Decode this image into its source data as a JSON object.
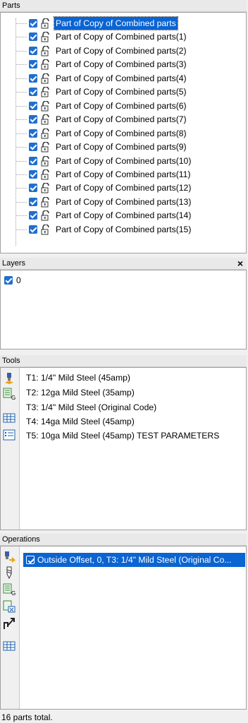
{
  "parts": {
    "title": "Parts",
    "items": [
      "Part of Copy of Combined parts",
      "Part of Copy of Combined parts(1)",
      "Part of Copy of Combined parts(2)",
      "Part of Copy of Combined parts(3)",
      "Part of Copy of Combined parts(4)",
      "Part of Copy of Combined parts(5)",
      "Part of Copy of Combined parts(6)",
      "Part of Copy of Combined parts(7)",
      "Part of Copy of Combined parts(8)",
      "Part of Copy of Combined parts(9)",
      "Part of Copy of Combined parts(10)",
      "Part of Copy of Combined parts(11)",
      "Part of Copy of Combined parts(12)",
      "Part of Copy of Combined parts(13)",
      "Part of Copy of Combined parts(14)",
      "Part of Copy of Combined parts(15)"
    ]
  },
  "layers": {
    "title": "Layers",
    "close": "×",
    "items": [
      "0"
    ]
  },
  "tools": {
    "title": "Tools",
    "items": [
      "T1: 1/4\" Mild Steel (45amp)",
      "T2: 12ga Mild Steel (35amp)",
      "T3: 1/4\" Mild Steel (Original Code)",
      "T4: 14ga Mild Steel (45amp)",
      "T5: 10ga Mild Steel (45amp) TEST PARAMETERS"
    ]
  },
  "operations": {
    "title": "Operations",
    "items": [
      "Outside Offset, 0, T3: 1/4\" Mild Steel (Original Co..."
    ]
  },
  "status": "16 parts total.",
  "colors": {
    "accent": "#0a64d2",
    "checkbox": "#1f6fd0"
  }
}
